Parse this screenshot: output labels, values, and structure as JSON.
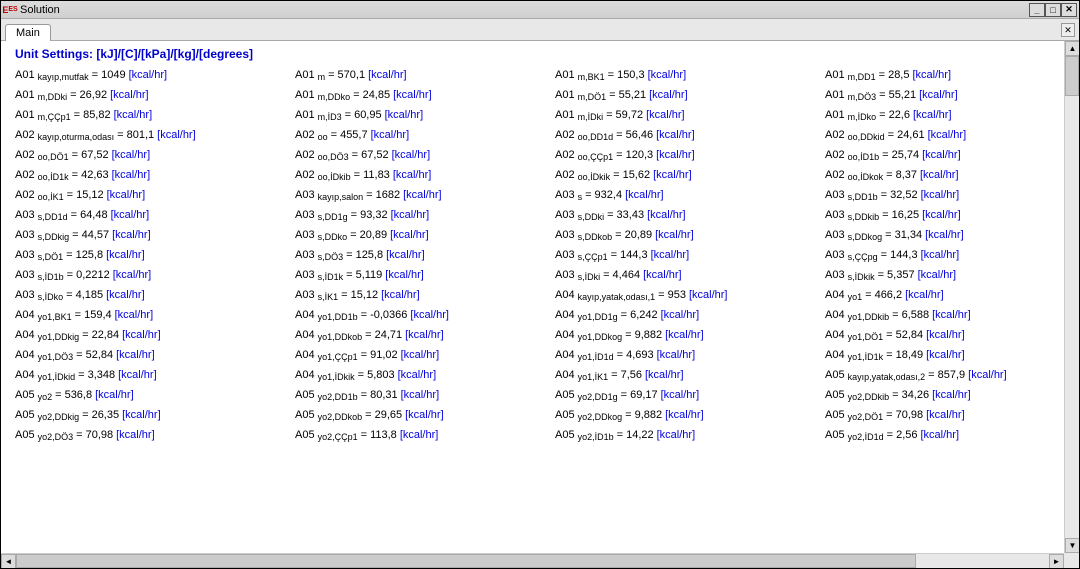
{
  "window": {
    "title": "Solution"
  },
  "tabs": {
    "main": "Main"
  },
  "unitSettings": "Unit Settings: [kJ]/[C]/[kPa]/[kg]/[degrees]",
  "unit": "[kcal/hr]",
  "rows": [
    [
      {
        "base": "A01",
        "sub": "kayıp,mutfak",
        "val": "1049"
      },
      {
        "base": "A01",
        "sub": "m",
        "val": "570,1"
      },
      {
        "base": "A01",
        "sub": "m,BK1",
        "val": "150,3"
      },
      {
        "base": "A01",
        "sub": "m,DD1",
        "val": "28,5"
      }
    ],
    [
      {
        "base": "A01",
        "sub": "m,DDki",
        "val": "26,92"
      },
      {
        "base": "A01",
        "sub": "m,DDko",
        "val": "24,85"
      },
      {
        "base": "A01",
        "sub": "m,DÖ1",
        "val": "55,21"
      },
      {
        "base": "A01",
        "sub": "m,DÖ3",
        "val": "55,21"
      }
    ],
    [
      {
        "base": "A01",
        "sub": "m,ÇÇp1",
        "val": "85,82"
      },
      {
        "base": "A01",
        "sub": "m,İD3",
        "val": "60,95"
      },
      {
        "base": "A01",
        "sub": "m,İDki",
        "val": "59,72"
      },
      {
        "base": "A01",
        "sub": "m,İDko",
        "val": "22,6"
      }
    ],
    [
      {
        "base": "A02",
        "sub": "kayıp,oturma,odası",
        "val": "801,1"
      },
      {
        "base": "A02",
        "sub": "oo",
        "val": "455,7"
      },
      {
        "base": "A02",
        "sub": "oo,DD1d",
        "val": "56,46"
      },
      {
        "base": "A02",
        "sub": "oo,DDkid",
        "val": "24,61"
      }
    ],
    [
      {
        "base": "A02",
        "sub": "oo,DÖ1",
        "val": "67,52"
      },
      {
        "base": "A02",
        "sub": "oo,DÖ3",
        "val": "67,52"
      },
      {
        "base": "A02",
        "sub": "oo,ÇÇp1",
        "val": "120,3"
      },
      {
        "base": "A02",
        "sub": "oo,İD1b",
        "val": "25,74"
      }
    ],
    [
      {
        "base": "A02",
        "sub": "oo,İD1k",
        "val": "42,63"
      },
      {
        "base": "A02",
        "sub": "oo,İDkib",
        "val": "11,83"
      },
      {
        "base": "A02",
        "sub": "oo,İDkik",
        "val": "15,62"
      },
      {
        "base": "A02",
        "sub": "oo,İDkok",
        "val": "8,37"
      }
    ],
    [
      {
        "base": "A02",
        "sub": "oo,İK1",
        "val": "15,12"
      },
      {
        "base": "A03",
        "sub": "kayıp,salon",
        "val": "1682"
      },
      {
        "base": "A03",
        "sub": "s",
        "val": "932,4"
      },
      {
        "base": "A03",
        "sub": "s,DD1b",
        "val": "32,52"
      }
    ],
    [
      {
        "base": "A03",
        "sub": "s,DD1d",
        "val": "64,48"
      },
      {
        "base": "A03",
        "sub": "s,DD1g",
        "val": "93,32"
      },
      {
        "base": "A03",
        "sub": "s,DDki",
        "val": "33,43"
      },
      {
        "base": "A03",
        "sub": "s,DDkib",
        "val": "16,25"
      }
    ],
    [
      {
        "base": "A03",
        "sub": "s,DDkig",
        "val": "44,57"
      },
      {
        "base": "A03",
        "sub": "s,DDko",
        "val": "20,89"
      },
      {
        "base": "A03",
        "sub": "s,DDkob",
        "val": "20,89"
      },
      {
        "base": "A03",
        "sub": "s,DDkog",
        "val": "31,34"
      }
    ],
    [
      {
        "base": "A03",
        "sub": "s,DÖ1",
        "val": "125,8"
      },
      {
        "base": "A03",
        "sub": "s,DÖ3",
        "val": "125,8"
      },
      {
        "base": "A03",
        "sub": "s,ÇÇp1",
        "val": "144,3"
      },
      {
        "base": "A03",
        "sub": "s,ÇÇpg",
        "val": "144,3"
      }
    ],
    [
      {
        "base": "A03",
        "sub": "s,İD1b",
        "val": "0,2212"
      },
      {
        "base": "A03",
        "sub": "s,İD1k",
        "val": "5,119"
      },
      {
        "base": "A03",
        "sub": "s,İDki",
        "val": "4,464"
      },
      {
        "base": "A03",
        "sub": "s,İDkik",
        "val": "5,357"
      }
    ],
    [
      {
        "base": "A03",
        "sub": "s,İDko",
        "val": "4,185"
      },
      {
        "base": "A03",
        "sub": "s,İK1",
        "val": "15,12"
      },
      {
        "base": "A04",
        "sub": "kayıp,yatak,odası,1",
        "val": "953"
      },
      {
        "base": "A04",
        "sub": "yo1",
        "val": "466,2"
      }
    ],
    [
      {
        "base": "A04",
        "sub": "yo1,BK1",
        "val": "159,4"
      },
      {
        "base": "A04",
        "sub": "yo1,DD1b",
        "val": "-0,0366"
      },
      {
        "base": "A04",
        "sub": "yo1,DD1g",
        "val": "6,242"
      },
      {
        "base": "A04",
        "sub": "yo1,DDkib",
        "val": "6,588"
      }
    ],
    [
      {
        "base": "A04",
        "sub": "yo1,DDkig",
        "val": "22,84"
      },
      {
        "base": "A04",
        "sub": "yo1,DDkob",
        "val": "24,71"
      },
      {
        "base": "A04",
        "sub": "yo1,DDkog",
        "val": "9,882"
      },
      {
        "base": "A04",
        "sub": "yo1,DÖ1",
        "val": "52,84"
      }
    ],
    [
      {
        "base": "A04",
        "sub": "yo1,DÖ3",
        "val": "52,84"
      },
      {
        "base": "A04",
        "sub": "yo1,ÇÇp1",
        "val": "91,02"
      },
      {
        "base": "A04",
        "sub": "yo1,İD1d",
        "val": "4,693"
      },
      {
        "base": "A04",
        "sub": "yo1,İD1k",
        "val": "18,49"
      }
    ],
    [
      {
        "base": "A04",
        "sub": "yo1,İDkid",
        "val": "3,348"
      },
      {
        "base": "A04",
        "sub": "yo1,İDkik",
        "val": "5,803"
      },
      {
        "base": "A04",
        "sub": "yo1,İK1",
        "val": "7,56"
      },
      {
        "base": "A05",
        "sub": "kayıp,yatak,odası,2",
        "val": "857,9"
      }
    ],
    [
      {
        "base": "A05",
        "sub": "yo2",
        "val": "536,8"
      },
      {
        "base": "A05",
        "sub": "yo2,DD1b",
        "val": "80,31"
      },
      {
        "base": "A05",
        "sub": "yo2,DD1g",
        "val": "69,17"
      },
      {
        "base": "A05",
        "sub": "yo2,DDkib",
        "val": "34,26"
      }
    ],
    [
      {
        "base": "A05",
        "sub": "yo2,DDkig",
        "val": "26,35"
      },
      {
        "base": "A05",
        "sub": "yo2,DDkob",
        "val": "29,65"
      },
      {
        "base": "A05",
        "sub": "yo2,DDkog",
        "val": "9,882"
      },
      {
        "base": "A05",
        "sub": "yo2,DÖ1",
        "val": "70,98"
      }
    ],
    [
      {
        "base": "A05",
        "sub": "yo2,DÖ3",
        "val": "70,98"
      },
      {
        "base": "A05",
        "sub": "yo2,ÇÇp1",
        "val": "113,8"
      },
      {
        "base": "A05",
        "sub": "yo2,İD1b",
        "val": "14,22"
      },
      {
        "base": "A05",
        "sub": "yo2,İD1d",
        "val": "2,56"
      }
    ]
  ]
}
